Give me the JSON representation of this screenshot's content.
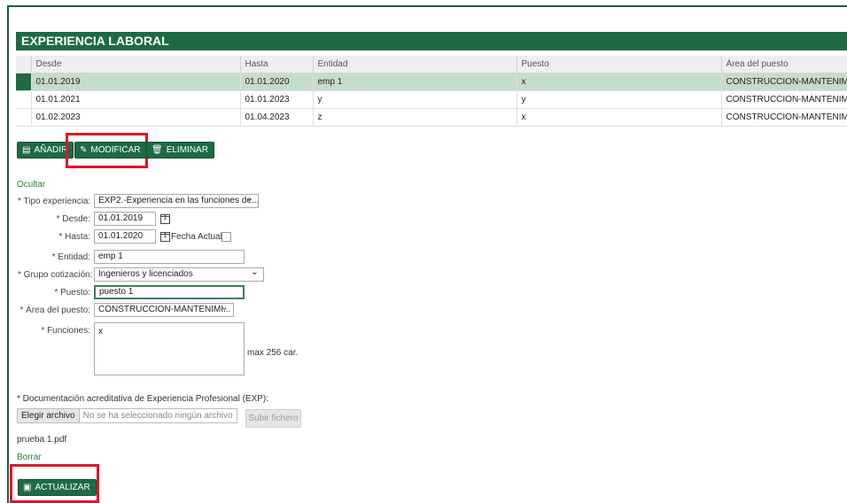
{
  "section": {
    "title": "EXPERIENCIA LABORAL"
  },
  "table": {
    "columns": [
      "Desde",
      "Hasta",
      "Entidad",
      "Puesto",
      "Área del puesto"
    ],
    "rows": [
      [
        "01.01.2019",
        "01.01.2020",
        "emp 1",
        "x",
        "CONSTRUCCION-MANTENIMIENTO"
      ],
      [
        "01.01.2021",
        "01.01.2023",
        "y",
        "y",
        "CONSTRUCCION-MANTENIMIENTO"
      ],
      [
        "01.02.2023",
        "01.04.2023",
        "z",
        "x",
        "CONSTRUCCION-MANTENIMIENTO"
      ]
    ],
    "selected_row": 0
  },
  "toolbar": {
    "add": "AÑADIR",
    "modify": "MODIFICAR",
    "delete": "ELIMINAR"
  },
  "form": {
    "hide_link": "Ocultar",
    "tipo_label": "* Tipo experiencia:",
    "tipo_value": "EXP2.-Experiencia en las funciones de...",
    "desde_label": "* Desde:",
    "desde_value": "01.01.2019",
    "hasta_label": "* Hasta:",
    "hasta_value": "01.01.2020",
    "calendar_glyph": "1",
    "fecha_actual_label": "Fecha Actual:",
    "entidad_label": "* Entidad:",
    "entidad_value": "emp 1",
    "grupo_label": "* Grupo cotización:",
    "grupo_value": "Ingenieros y licenciados",
    "puesto_label": "* Puesto:",
    "puesto_value": "puesto 1",
    "area_label": "* Área del puesto:",
    "area_value": "CONSTRUCCION-MANTENIMI...",
    "funciones_label": "* Funciones:",
    "funciones_value": "x",
    "max_chars": "max 256 car.",
    "doc_label": "* Documentación acreditativa de Experiencia Profesional (EXP):",
    "file_button": "Elegir archivo",
    "file_none": "No se ha seleccionado ningún archivo",
    "upload_button": "Subir fichero",
    "uploaded_file": "prueba 1.pdf",
    "delete_link": "Borrar",
    "update_button": "ACTUALIZAR"
  },
  "colors": {
    "brand_green": "#1e6b43",
    "selected_row": "#c6dcca",
    "highlight_red": "#e0162b"
  }
}
